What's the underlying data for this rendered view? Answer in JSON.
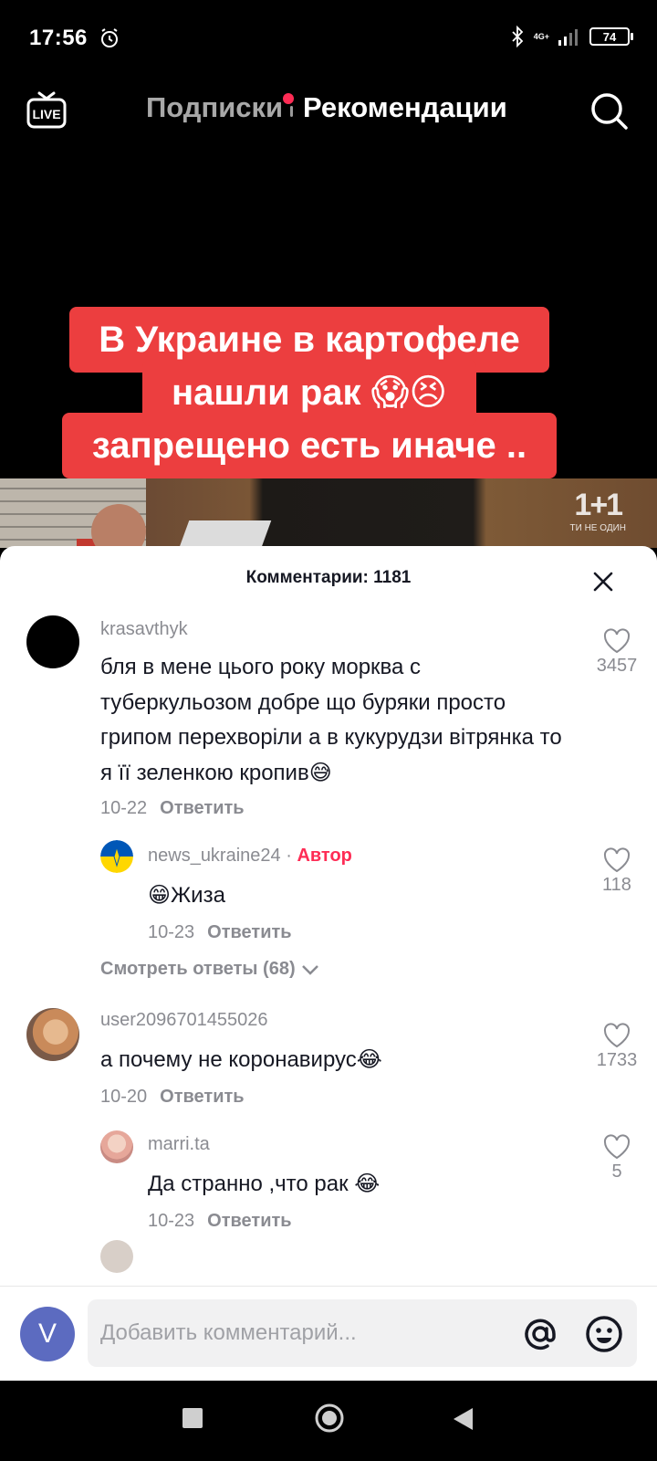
{
  "status_bar": {
    "time": "17:56",
    "network": "4G+",
    "battery": "74"
  },
  "top_nav": {
    "tabs": [
      {
        "label": "Подписки"
      },
      {
        "label": "Рекомендации"
      }
    ],
    "live_label": "LIVE"
  },
  "video": {
    "caption_lines": [
      "В Украине в картофеле",
      "нашли рак 😱😣",
      "запрещено есть иначе .."
    ],
    "watermark": "1+1",
    "watermark_sub": "ТИ НЕ ОДИН"
  },
  "comments_sheet": {
    "title": "Комментарии: 1181",
    "reply_label": "Ответить",
    "comments": [
      {
        "username": "krasavthyk",
        "text": "бля в мене цього року морква с туберкульозом добре що буряки просто грипом перехворіли а в кукурудзи вітрянка то я її зеленкою кропив😅",
        "date": "10-22",
        "likes": "3457"
      },
      {
        "username": "news_ukraine24",
        "badge": "Автор",
        "separator": "·",
        "text": "😁Жиза",
        "date": "10-23",
        "likes": "118"
      },
      {
        "view_replies": "Смотреть ответы (68)"
      },
      {
        "username": "user2096701455026",
        "text": "а почему не коронавирус😂",
        "date": "10-20",
        "likes": "1733"
      },
      {
        "username": "marri.ta",
        "text": "Да странно ,что рак 😂",
        "date": "10-23",
        "likes": "5"
      }
    ]
  },
  "input_bar": {
    "avatar_letter": "V",
    "placeholder": "Добавить комментарий..."
  },
  "colors": {
    "accent": "#fe2c55",
    "caption_bg": "#ec3e3f",
    "avatar_bg": "#5c6bc0"
  }
}
